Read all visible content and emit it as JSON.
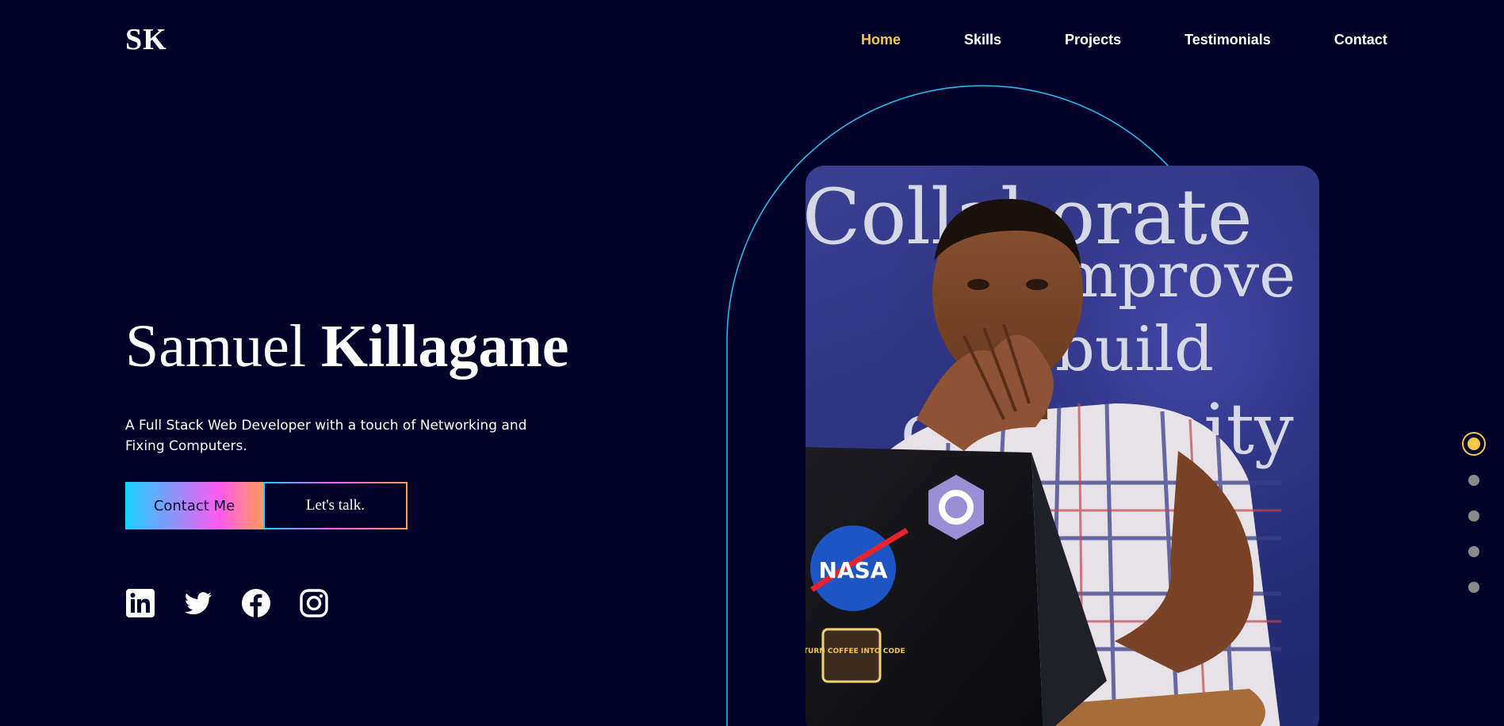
{
  "header": {
    "logo": "SK",
    "nav": [
      {
        "label": "Home",
        "active": true
      },
      {
        "label": "Skills",
        "active": false
      },
      {
        "label": "Projects",
        "active": false
      },
      {
        "label": "Testimonials",
        "active": false
      },
      {
        "label": "Contact",
        "active": false
      }
    ]
  },
  "hero": {
    "first_name": "Samuel",
    "last_name": "Killagane",
    "description": "A Full Stack Web Developer with a touch of Networking and Fixing Computers.",
    "primary_button": "Contact Me",
    "secondary_button": "Let's talk."
  },
  "social": [
    "linkedin-icon",
    "twitter-icon",
    "facebook-icon",
    "instagram-icon"
  ],
  "portrait": {
    "wall_text": [
      "Collaborate",
      "improve",
      "build",
      "community"
    ],
    "stickers": [
      "NASA",
      "I TURN COFFEE INTO CODE"
    ]
  },
  "page_dots": {
    "count": 5,
    "active_index": 0
  },
  "colors": {
    "background": "#02012a",
    "accent": "#f7c948",
    "arch_line": "#2bb7ea",
    "gradient": [
      "#1ad0ff",
      "#ff5af1",
      "#ff9a5a"
    ]
  }
}
